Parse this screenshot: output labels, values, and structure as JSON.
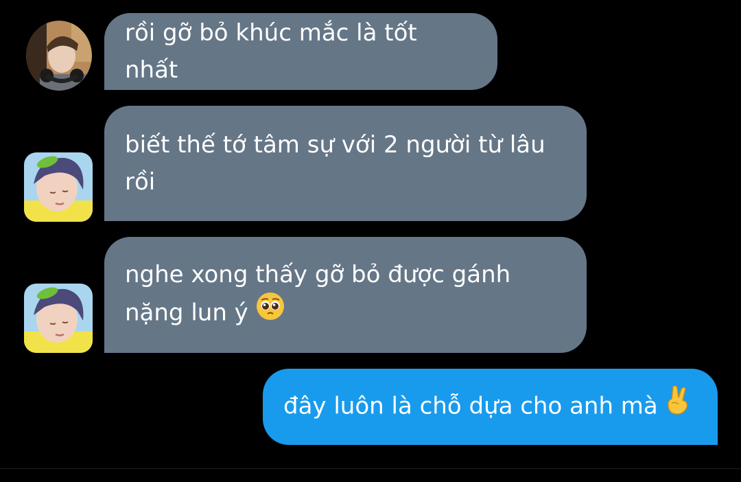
{
  "messages": [
    {
      "direction": "incoming",
      "text": "rồi gỡ bỏ khúc mắc là tốt nhất",
      "avatar": "avatar-person-headphones"
    },
    {
      "direction": "incoming",
      "text": "biết thế tớ tâm sự với 2 người từ lâu\nrồi",
      "avatar": "avatar-person-leaf-clip"
    },
    {
      "direction": "incoming",
      "text_line1": "nghe xong thấy gỡ bỏ được gánh",
      "text_line2": "nặng lun ý",
      "emoji": "pleading-face-emoji",
      "avatar": "avatar-person-leaf-clip"
    },
    {
      "direction": "outgoing",
      "text": "đây luôn là chỗ dựa cho anh mà",
      "emoji": "crossed-fingers-emoji"
    }
  ],
  "colors": {
    "background": "#000000",
    "incoming_bubble": "#657687",
    "outgoing_bubble": "#189bed",
    "text": "#ffffff"
  }
}
